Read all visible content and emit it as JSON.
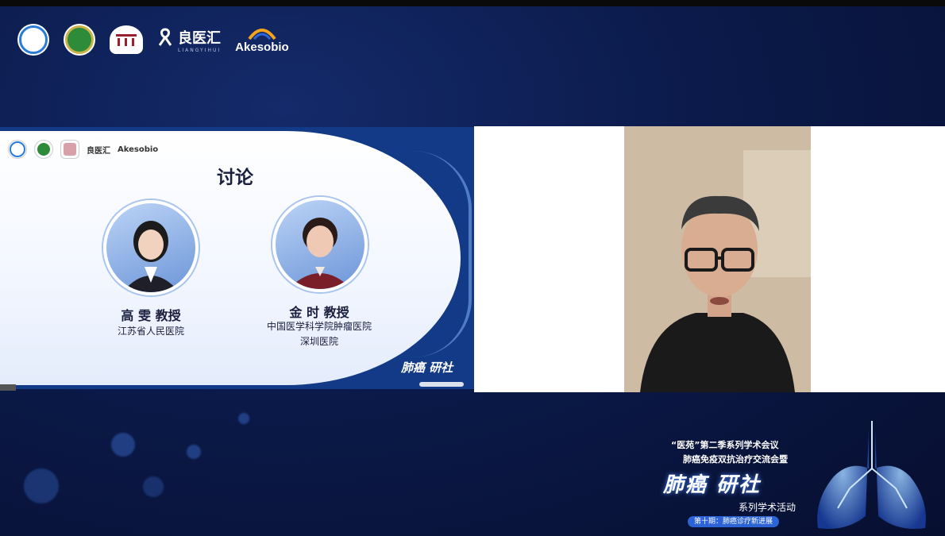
{
  "header": {
    "logos": {
      "akesobio": "Akesobio",
      "lianghui_cn": "良医汇",
      "lianghui_en": "LIANGYIHUI"
    }
  },
  "slide": {
    "title": "讨论",
    "logos": {
      "lianghui_cn": "良医汇",
      "akesobio": "Akesobio"
    },
    "speakers": [
      {
        "name": "高 雯 教授",
        "affiliation_line1": "江苏省人民医院",
        "affiliation_line2": ""
      },
      {
        "name": "金 时 教授",
        "affiliation_line1": "中国医学科学院肿瘤医院",
        "affiliation_line2": "深圳医院"
      }
    ],
    "brand": "肺癌 研社"
  },
  "banner": {
    "quote_line": "“医苑”第二季系列学术会议",
    "sub_line": "肺癌免疫双抗治疗交流会暨",
    "title": "肺癌 研社",
    "series": "系列学术活动",
    "pill": "第十期：肺癌诊疗新进展"
  },
  "colors": {
    "background": "#0b1a4a",
    "slide_accent": "#123a86",
    "akeso_orange": "#f2a21b",
    "akeso_blue": "#2c63d6"
  }
}
